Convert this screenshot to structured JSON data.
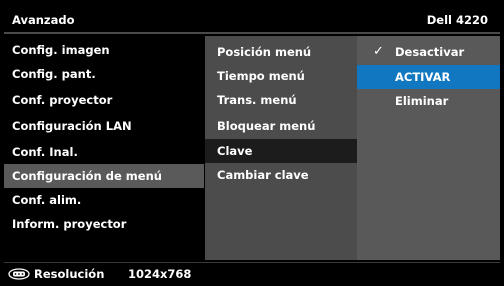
{
  "header": {
    "title": "Avanzado",
    "model": "Dell 4220"
  },
  "left_menu": [
    "Config. imagen",
    "Config. pant.",
    "Conf. proyector",
    "Configuración LAN",
    "Conf. Inal.",
    "Configuración de menú",
    "Conf. alim.",
    "Inform. proyector"
  ],
  "left_selected": "Configuración de menú",
  "mid_menu": [
    "Posición menú",
    "Tiempo menú",
    "Trans. menú",
    "Bloquear menú",
    "Clave",
    "Cambiar clave"
  ],
  "mid_selected": "Clave",
  "right_menu": [
    "Desactivar",
    "ACTIVAR",
    "Eliminar"
  ],
  "right_checked": "Desactivar",
  "right_highlighted": "ACTIVAR",
  "footer": {
    "label": "Resolución",
    "value": "1024x768",
    "icon": "vga-input-icon"
  },
  "colors": {
    "highlight": "#1177c1",
    "left_selected_bg": "#5a5a5a",
    "mid_bg": "#4c4c4c",
    "mid_selected_bg": "#1c1c1c",
    "right_bg": "#595959"
  }
}
